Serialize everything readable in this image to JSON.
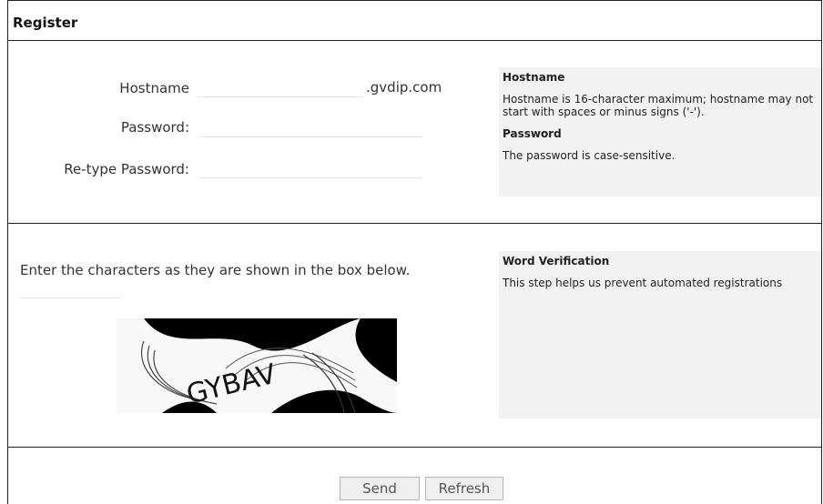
{
  "title": "Register",
  "form": {
    "hostname_label": "Hostname",
    "hostname_suffix": ".gvdip.com",
    "password_label": "Password:",
    "retype_label": "Re-type Password:",
    "hostname_value": "",
    "password_value": "",
    "retype_value": ""
  },
  "help": {
    "hostname_heading": "Hostname",
    "hostname_text": "Hostname is 16-character maximum; hostname may not start with spaces or minus signs ('-').",
    "password_heading": "Password",
    "password_text": "The password is case-sensitive.",
    "verification_heading": "Word Verification",
    "verification_text": "This step helps us prevent automated registrations"
  },
  "captcha": {
    "instruction": "Enter the characters as they are shown in the box below.",
    "input_value": "",
    "characters": "GYBAV"
  },
  "buttons": {
    "send": "Send",
    "refresh": "Refresh"
  }
}
